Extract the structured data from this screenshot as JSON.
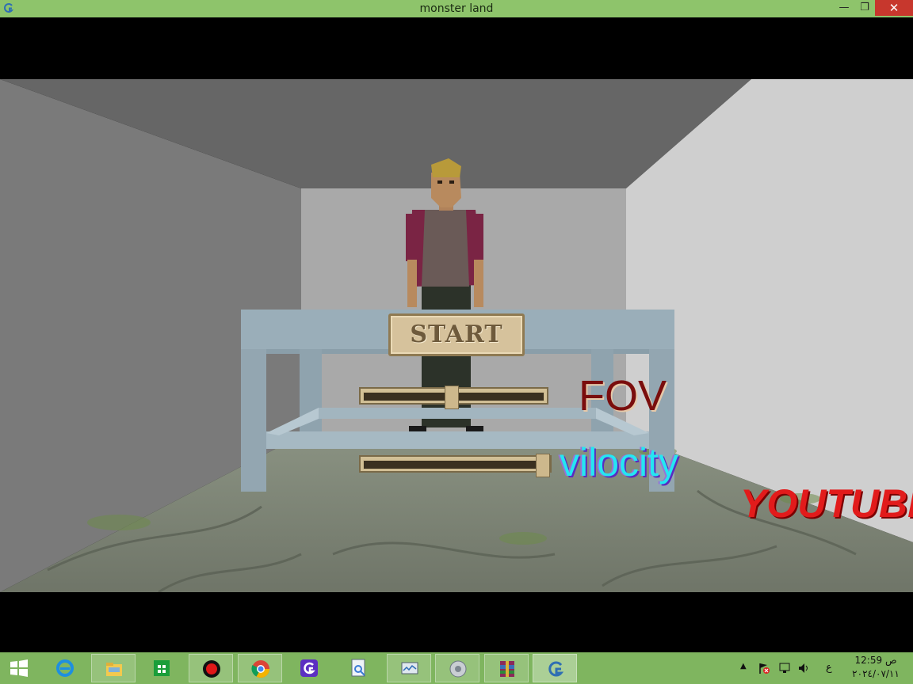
{
  "window": {
    "title": "monster land",
    "minimize_glyph": "—",
    "restore_glyph": "❐",
    "close_glyph": "✕",
    "app_icon": "game-engine-icon"
  },
  "menu": {
    "start_label": "START",
    "fov_label": "FOV",
    "velocity_label": "vilocity",
    "youtube_label": "YOUTUBE",
    "fov_value": 0.49,
    "velocity_value": 1.0
  },
  "colors": {
    "titlebar": "#8ec46b",
    "taskbar": "#7fb55f",
    "fov_text": "#7a0d0d",
    "velocity_text": "#25e6f2",
    "youtube_text": "#e21b1b"
  },
  "taskbar": {
    "apps": [
      {
        "name": "windows-start-icon"
      },
      {
        "name": "internet-explorer-icon"
      },
      {
        "name": "file-explorer-icon"
      },
      {
        "name": "store-icon"
      },
      {
        "name": "screen-recorder-icon"
      },
      {
        "name": "chrome-icon"
      },
      {
        "name": "gdevelop-icon"
      },
      {
        "name": "ocr-tool-icon"
      },
      {
        "name": "monitor-app-icon"
      },
      {
        "name": "speaker-app-icon"
      },
      {
        "name": "winrar-icon"
      },
      {
        "name": "game-engine-icon"
      }
    ],
    "tray": {
      "show_hidden": "▲",
      "input_lang": "ع",
      "time": "12:59 ص",
      "date": "٢٠٢٤/٠٧/١١"
    }
  }
}
